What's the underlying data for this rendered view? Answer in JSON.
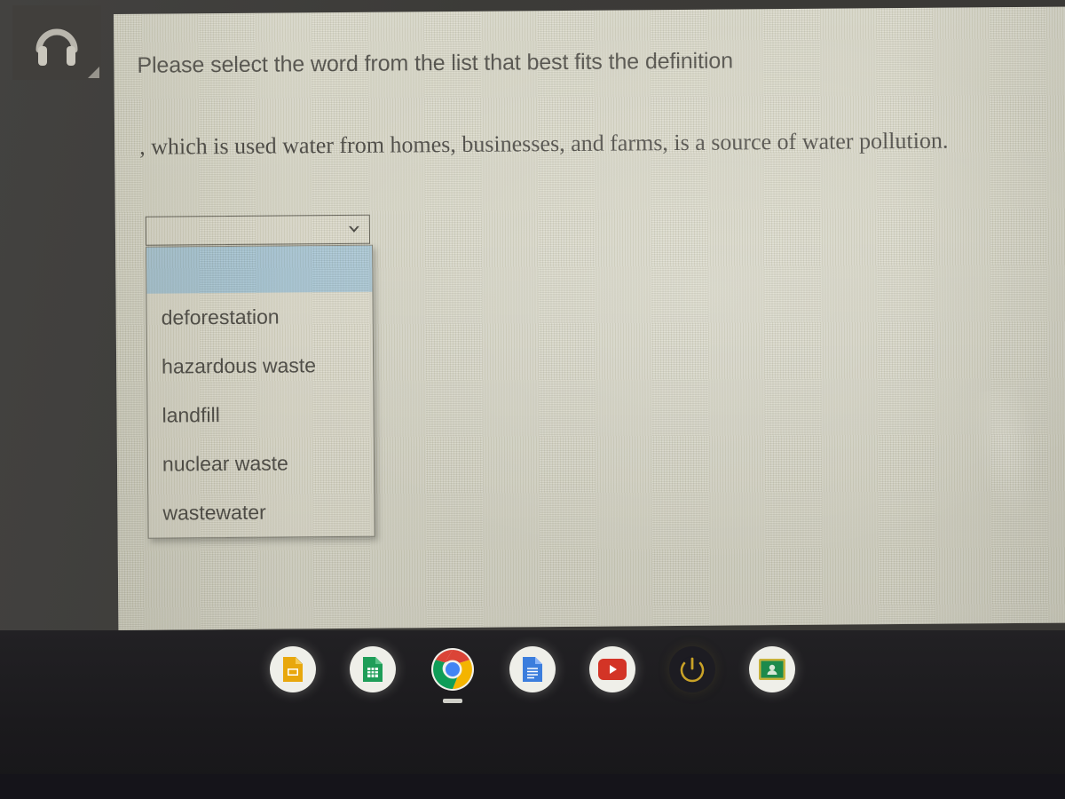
{
  "device": {
    "corner_icon": "headphones-icon",
    "screen_bg_color": "#d9d8c9",
    "bezel_color": "#3a3936"
  },
  "page": {
    "heading": "Please select the word from the list that best fits the definition",
    "question_text": ", which is used water from homes, businesses, and farms, is a source of water pollution.",
    "heading_color": "#46443f",
    "question_color": "#403e3a"
  },
  "dropdown": {
    "state": "open",
    "selected_value": "",
    "highlight_color": "#a7c6d6",
    "chevron_icon": "chevron-down-icon",
    "options": [
      {
        "label": "",
        "highlighted": true
      },
      {
        "label": "deforestation",
        "highlighted": false
      },
      {
        "label": "hazardous waste",
        "highlighted": false
      },
      {
        "label": "landfill",
        "highlighted": false
      },
      {
        "label": "nuclear waste",
        "highlighted": false
      },
      {
        "label": "wastewater",
        "highlighted": false
      }
    ]
  },
  "shelf": {
    "items": [
      {
        "name": "google-slides",
        "icon": "slides-icon",
        "color": "#e8a70c",
        "active": false
      },
      {
        "name": "google-sheets",
        "icon": "sheets-icon",
        "color": "#1e9d58",
        "active": false
      },
      {
        "name": "google-chrome",
        "icon": "chrome-icon",
        "color": "#4285f4",
        "active": true
      },
      {
        "name": "google-docs",
        "icon": "docs-icon",
        "color": "#3b7ddd",
        "active": false
      },
      {
        "name": "youtube",
        "icon": "youtube-icon",
        "color": "#d33426",
        "active": false
      },
      {
        "name": "power",
        "icon": "power-icon",
        "color": "#c9a227",
        "active": false
      },
      {
        "name": "google-classroom",
        "icon": "classroom-icon",
        "color": "#1d8a4c",
        "active": false
      }
    ]
  }
}
